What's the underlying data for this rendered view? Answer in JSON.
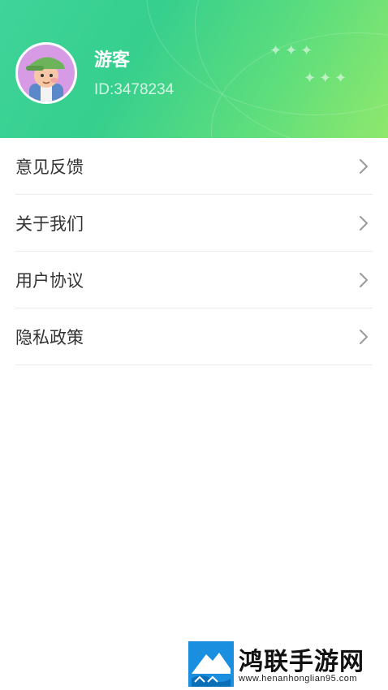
{
  "profile": {
    "name": "游客",
    "id_text": "ID:3478234"
  },
  "menu": {
    "items": [
      {
        "label": "意见反馈",
        "icon": "chevron-right-icon"
      },
      {
        "label": "关于我们",
        "icon": "chevron-right-icon"
      },
      {
        "label": "用户协议",
        "icon": "chevron-right-icon"
      },
      {
        "label": "隐私政策",
        "icon": "chevron-right-icon"
      }
    ]
  },
  "watermark": {
    "title": "鸿联手游网",
    "url": "www.henanhonglian95.com"
  },
  "colors": {
    "header_start": "#3fd49a",
    "header_end": "#8fe86c",
    "text_primary": "#333333",
    "divider": "#ececec",
    "watermark_blue": "#1a8fe0"
  }
}
